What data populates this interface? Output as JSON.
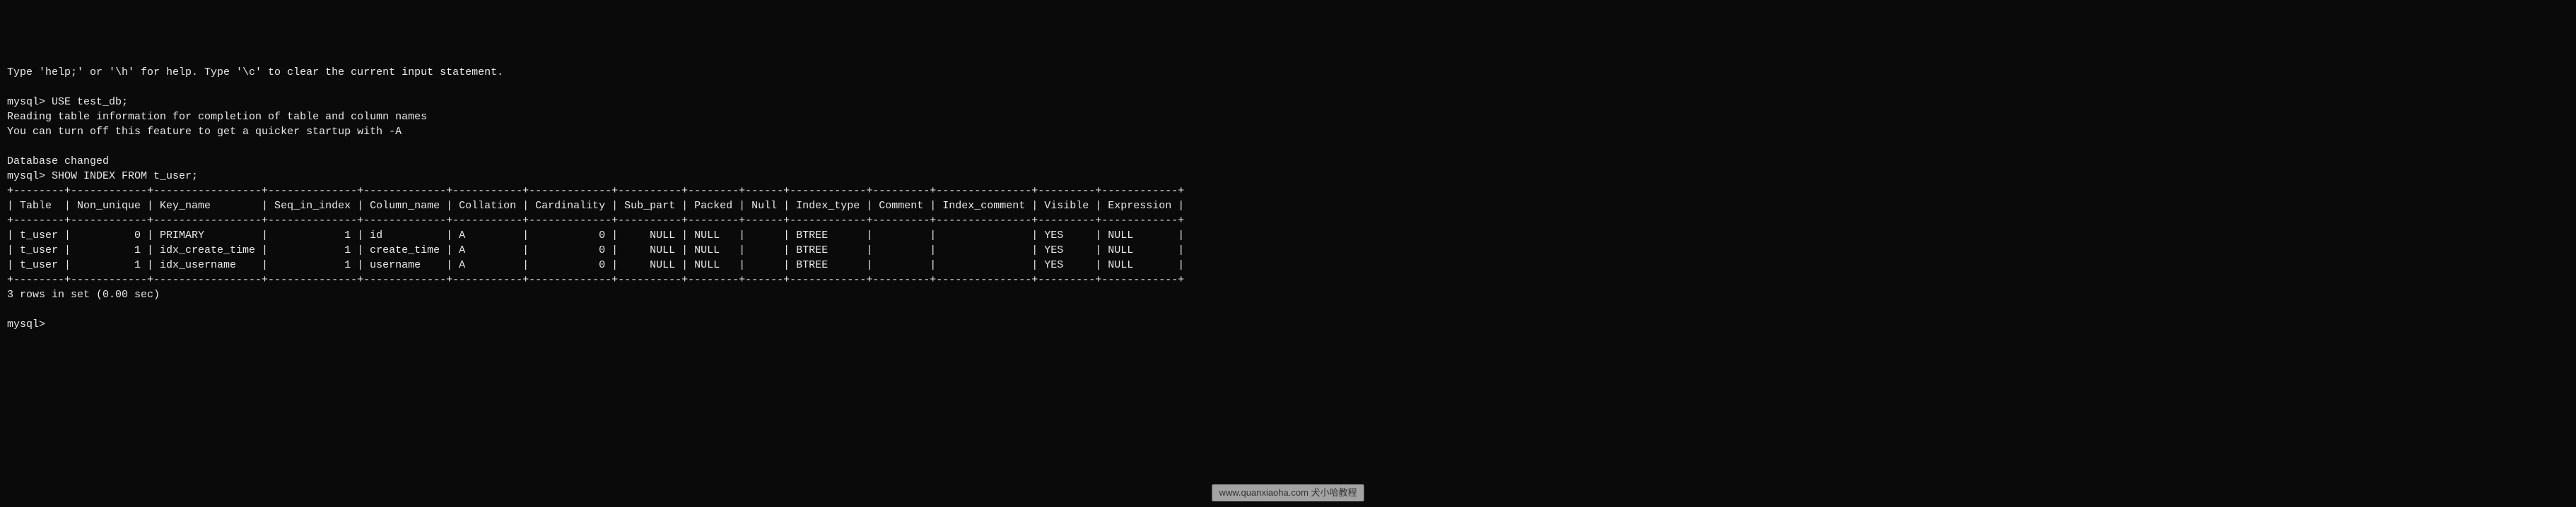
{
  "chart_data": {
    "type": "table",
    "title": "SHOW INDEX FROM t_user",
    "columns": [
      "Table",
      "Non_unique",
      "Key_name",
      "Seq_in_index",
      "Column_name",
      "Collation",
      "Cardinality",
      "Sub_part",
      "Packed",
      "Null",
      "Index_type",
      "Comment",
      "Index_comment",
      "Visible",
      "Expression"
    ],
    "rows": [
      [
        "t_user",
        0,
        "PRIMARY",
        1,
        "id",
        "A",
        0,
        "NULL",
        "NULL",
        "",
        "BTREE",
        "",
        "",
        "YES",
        "NULL"
      ],
      [
        "t_user",
        1,
        "idx_create_time",
        1,
        "create_time",
        "A",
        0,
        "NULL",
        "NULL",
        "",
        "BTREE",
        "",
        "",
        "YES",
        "NULL"
      ],
      [
        "t_user",
        1,
        "idx_username",
        1,
        "username",
        "A",
        0,
        "NULL",
        "NULL",
        "",
        "BTREE",
        "",
        "",
        "YES",
        "NULL"
      ]
    ]
  },
  "help_line": "Type 'help;' or '\\h' for help. Type '\\c' to clear the current input statement.",
  "blank1": "",
  "cmd1_prompt": "mysql> ",
  "cmd1": "USE test_db;",
  "reading_info1": "Reading table information for completion of table and column names",
  "reading_info2": "You can turn off this feature to get a quicker startup with -A",
  "blank2": "",
  "db_changed": "Database changed",
  "cmd2_prompt": "mysql> ",
  "cmd2": "SHOW INDEX FROM t_user;",
  "table_border": "+--------+------------+-----------------+--------------+-------------+-----------+-------------+----------+--------+------+------------+---------+---------------+---------+------------+",
  "table_header": "| Table  | Non_unique | Key_name        | Seq_in_index | Column_name | Collation | Cardinality | Sub_part | Packed | Null | Index_type | Comment | Index_comment | Visible | Expression |",
  "table_row1": "| t_user |          0 | PRIMARY         |            1 | id          | A         |           0 |     NULL | NULL   |      | BTREE      |         |               | YES     | NULL       |",
  "table_row2": "| t_user |          1 | idx_create_time |            1 | create_time | A         |           0 |     NULL | NULL   |      | BTREE      |         |               | YES     | NULL       |",
  "table_row3": "| t_user |          1 | idx_username    |            1 | username    | A         |           0 |     NULL | NULL   |      | BTREE      |         |               | YES     | NULL       |",
  "result_summary": "3 rows in set (0.00 sec)",
  "blank3": "",
  "cmd3_prompt": "mysql> ",
  "watermark_text": "www.quanxiaoha.com 犬小哈教程"
}
